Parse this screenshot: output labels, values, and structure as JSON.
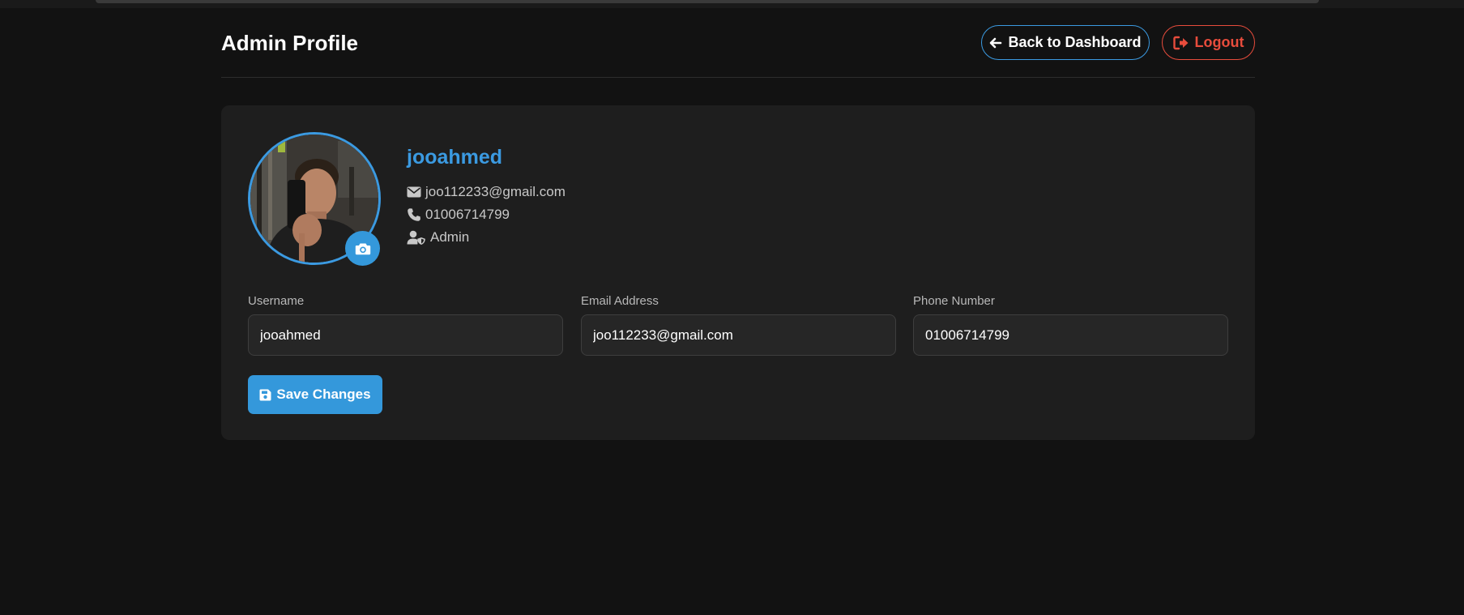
{
  "header": {
    "title": "Admin Profile",
    "back_label": "Back to Dashboard",
    "logout_label": "Logout"
  },
  "profile": {
    "name": "jooahmed",
    "email": "joo112233@gmail.com",
    "phone": "01006714799",
    "role": "Admin"
  },
  "form": {
    "username_label": "Username",
    "username_value": "jooahmed",
    "email_label": "Email Address",
    "email_value": "joo112233@gmail.com",
    "phone_label": "Phone Number",
    "phone_value": "01006714799",
    "save_label": "Save Changes"
  },
  "icons": {
    "back": "arrow-left-icon",
    "logout": "sign-out-icon",
    "camera": "camera-icon",
    "email": "envelope-icon",
    "phone": "phone-icon",
    "role": "user-shield-icon",
    "save": "floppy-disk-icon"
  },
  "colors": {
    "background": "#121212",
    "card": "#1e1e1e",
    "accent": "#3b9ae1",
    "danger": "#e74c3c"
  }
}
